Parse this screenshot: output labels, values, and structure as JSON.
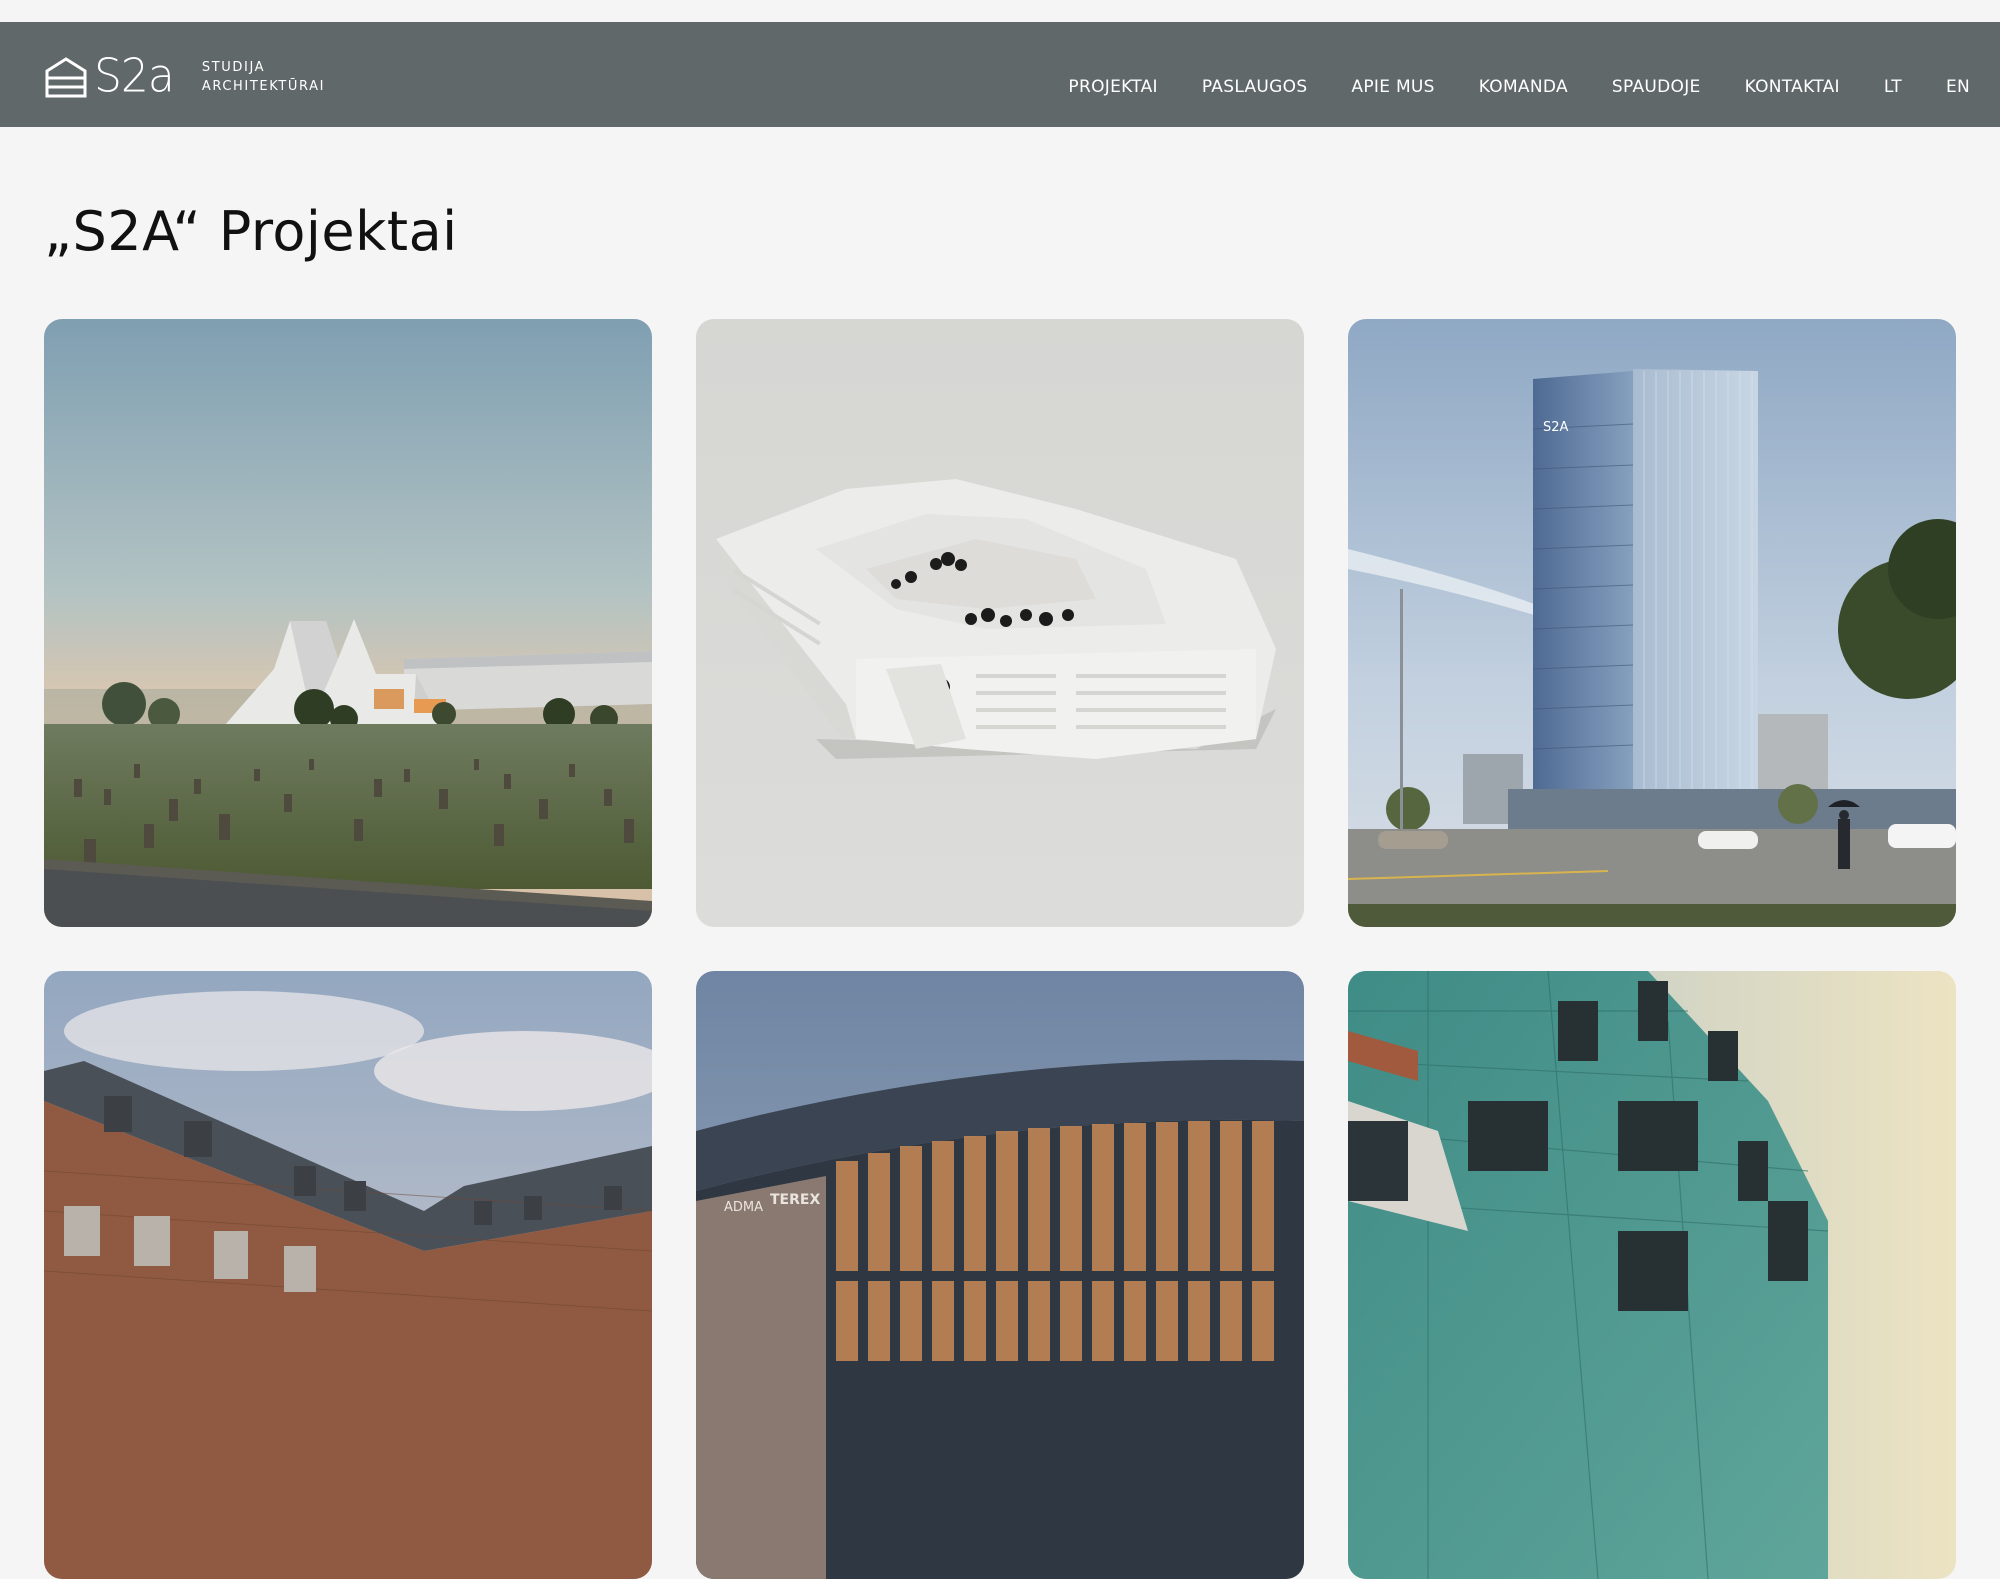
{
  "logo": {
    "wordmark": "S2a",
    "line1": "STUDIJA",
    "line2": "ARCHITEKTŪRAI"
  },
  "nav": {
    "items": [
      {
        "label": "PROJEKTAI"
      },
      {
        "label": "PASLAUGOS"
      },
      {
        "label": "APIE MUS"
      },
      {
        "label": "KOMANDA"
      },
      {
        "label": "SPAUDOJE"
      },
      {
        "label": "KONTAKTAI"
      },
      {
        "label": "LT"
      },
      {
        "label": "EN"
      }
    ]
  },
  "page": {
    "title": "„S2A“ Projektai"
  },
  "projects": {
    "tower_sign": "S2A",
    "mall_signs": [
      "ADMA",
      "TEREX"
    ]
  },
  "colors": {
    "navbar": "#616869",
    "background": "#f5f5f5",
    "text": "#111111"
  }
}
